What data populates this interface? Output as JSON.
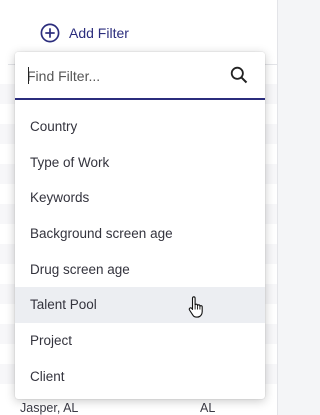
{
  "toolbar": {
    "add_filter_label": "Add Filter"
  },
  "filter_menu": {
    "search_placeholder": "Find Filter...",
    "options": [
      {
        "label": "Country"
      },
      {
        "label": "Type of Work"
      },
      {
        "label": "Keywords"
      },
      {
        "label": "Background screen age"
      },
      {
        "label": "Drug screen age"
      },
      {
        "label": "Talent Pool",
        "hovered": true
      },
      {
        "label": "Project"
      },
      {
        "label": "Client"
      }
    ]
  },
  "background_table": {
    "visible_row": {
      "city": "Jasper, AL",
      "state": "AL"
    }
  },
  "colors": {
    "accent": "#2b2d7d",
    "hover": "#eceef2"
  },
  "icons": {
    "add": "plus-circle-icon",
    "search": "search-icon",
    "cursor": "hand-pointer-icon"
  }
}
